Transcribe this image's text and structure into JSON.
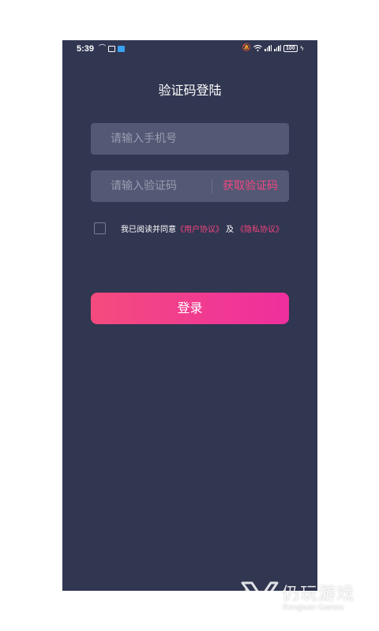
{
  "status_bar": {
    "time": "5:39",
    "battery": "100",
    "icons": [
      "missed-call-icon",
      "message-icon",
      "app-notification-icon",
      "mute-icon",
      "wifi-icon",
      "signal-icon",
      "signal-icon",
      "battery-icon",
      "charging-icon"
    ]
  },
  "page": {
    "title": "验证码登陆"
  },
  "form": {
    "phone_placeholder": "请输入手机号",
    "code_placeholder": "请输入验证码",
    "get_code_label": "获取验证码"
  },
  "agreement": {
    "checked": false,
    "prefix": "我已阅读并同意",
    "user_agreement": "《用户协议》",
    "and": "及",
    "privacy_policy": "《隐私协议》"
  },
  "login_button": {
    "label": "登录"
  },
  "colors": {
    "background": "#313651",
    "input_bg": "#535874",
    "accent": "#f2467f",
    "button_gradient": [
      "#f44b7e",
      "#ee2f9e"
    ]
  },
  "watermark": {
    "name": "仍玩游戏",
    "sub": "Rengwan Games"
  }
}
